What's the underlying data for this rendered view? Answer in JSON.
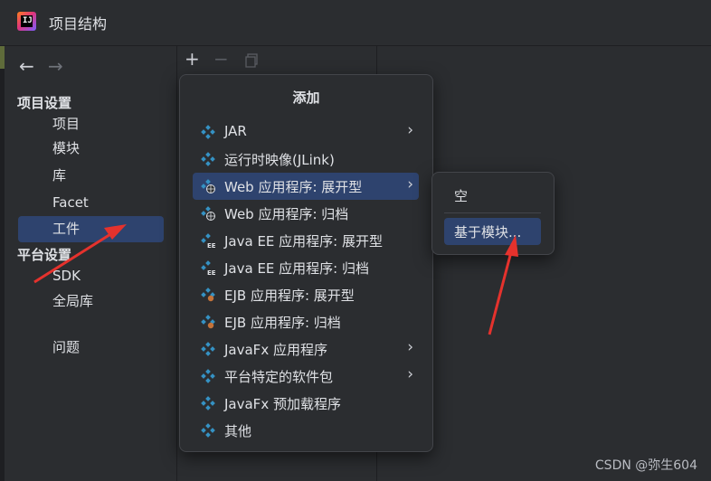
{
  "window": {
    "title": "项目结构"
  },
  "sidebar": {
    "sections": [
      {
        "title": "项目设置",
        "items": [
          "项目",
          "模块",
          "库",
          "Facet",
          "工件"
        ]
      },
      {
        "title": "平台设置",
        "items": [
          "SDK",
          "全局库"
        ]
      }
    ],
    "extra_items": [
      "问题"
    ],
    "selected": "工件"
  },
  "popup": {
    "title": "添加",
    "items": [
      {
        "label": "JAR",
        "has_submenu": true,
        "icon": "jar-icon"
      },
      {
        "label": "运行时映像(JLink)",
        "has_submenu": false,
        "icon": "artifact-icon"
      },
      {
        "label": "Web 应用程序: 展开型",
        "has_submenu": true,
        "icon": "web-app-icon",
        "active": true
      },
      {
        "label": "Web 应用程序: 归档",
        "has_submenu": false,
        "icon": "web-app-icon"
      },
      {
        "label": "Java EE 应用程序: 展开型",
        "has_submenu": false,
        "icon": "javaee-icon"
      },
      {
        "label": "Java EE 应用程序: 归档",
        "has_submenu": false,
        "icon": "javaee-icon"
      },
      {
        "label": "EJB 应用程序: 展开型",
        "has_submenu": false,
        "icon": "ejb-icon"
      },
      {
        "label": "EJB 应用程序: 归档",
        "has_submenu": false,
        "icon": "ejb-icon"
      },
      {
        "label": "JavaFx 应用程序",
        "has_submenu": true,
        "icon": "artifact-icon"
      },
      {
        "label": "平台特定的软件包",
        "has_submenu": true,
        "icon": "artifact-icon"
      },
      {
        "label": "JavaFx 预加载程序",
        "has_submenu": false,
        "icon": "artifact-icon"
      },
      {
        "label": "其他",
        "has_submenu": false,
        "icon": "artifact-icon"
      }
    ]
  },
  "submenu": {
    "items": [
      "空",
      "基于模块..."
    ],
    "active": "基于模块..."
  },
  "watermark": "CSDN @弥生604",
  "colors": {
    "background": "#2b2d30",
    "selection": "#2e436e",
    "artifact_icon": "#3592c4",
    "annotation_arrow": "#e5322d"
  }
}
